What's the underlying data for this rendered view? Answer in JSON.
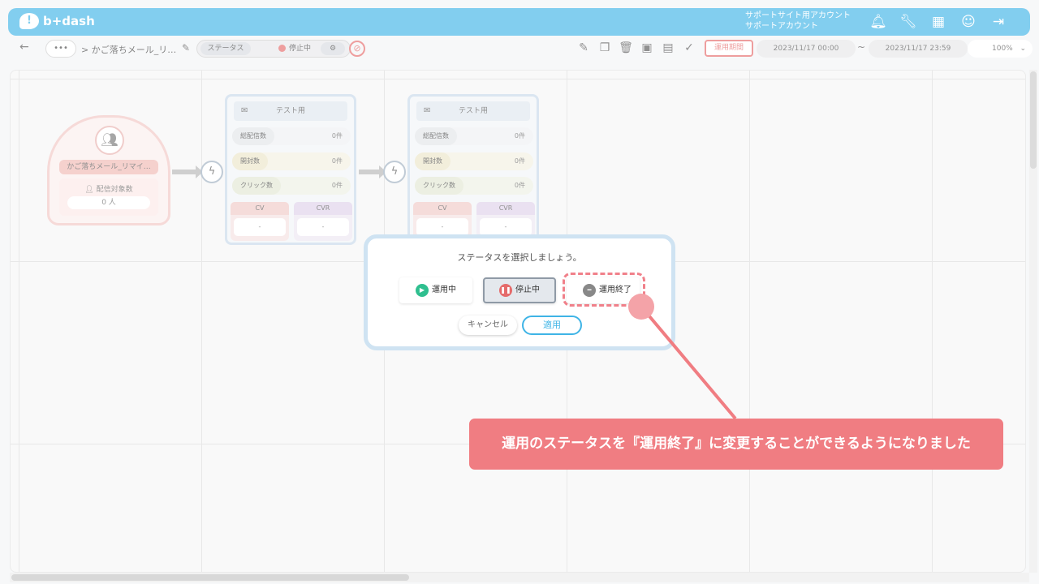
{
  "header": {
    "logo_text": "b+dash",
    "account_line1": "サポートサイト用アカウント",
    "account_line2": "サポートアカウント",
    "icons": [
      "bell-icon",
      "wrench-icon",
      "grid-icon",
      "support-chat-icon",
      "logout-icon"
    ]
  },
  "toolbar": {
    "back_glyph": "←",
    "more_glyph": "•••",
    "breadcrumb": "> かご落ちメール_リ…",
    "status_label": "ステータス",
    "status_value": "停止中",
    "period_label": "運用期間",
    "start_date": "2023/11/17 00:00",
    "tilde": "~",
    "end_date": "2023/11/17 23:59",
    "zoom": "100%",
    "tool_icons": [
      "edit-icon",
      "copy-icon",
      "trash-icon",
      "archive-icon",
      "document-icon",
      "check-circle-icon"
    ]
  },
  "canvas": {
    "segment": {
      "title": "かご落ちメール_リマイ…",
      "target_label": "配信対象数",
      "target_count": "0 人"
    },
    "mail_nodes": [
      {
        "title": "テスト用",
        "metrics": [
          {
            "label": "総配信数",
            "value": "0件"
          },
          {
            "label": "開封数",
            "value": "0件"
          },
          {
            "label": "クリック数",
            "value": "0件"
          }
        ],
        "cv_label": "CV",
        "cv_value": "-",
        "cvr_label": "CVR",
        "cvr_value": "-"
      },
      {
        "title": "テスト用",
        "metrics": [
          {
            "label": "総配信数",
            "value": "0件"
          },
          {
            "label": "開封数",
            "value": "0件"
          },
          {
            "label": "クリック数",
            "value": "0件"
          }
        ],
        "cv_label": "CV",
        "cv_value": "-",
        "cvr_label": "CVR",
        "cvr_value": "-"
      }
    ]
  },
  "modal": {
    "title": "ステータスを選択しましょう。",
    "options": [
      {
        "label": "運用中",
        "color": "#2fbf8f"
      },
      {
        "label": "停止中",
        "color": "#e56b6b"
      },
      {
        "label": "運用終了",
        "color": "#888888"
      }
    ],
    "cancel": "キャンセル",
    "apply": "適用"
  },
  "callout": {
    "text": "運用のステータスを『運用終了』に変更することができるようになりました",
    "color": "#f07d82"
  },
  "colors": {
    "brand": "#3fb4e6",
    "alert": "#e56b6b"
  }
}
